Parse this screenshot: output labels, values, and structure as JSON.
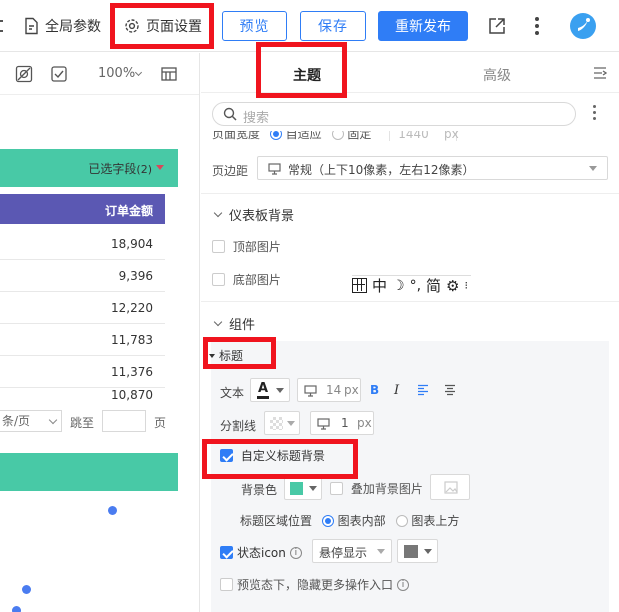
{
  "toolbar": {
    "global_params": "全局参数",
    "page_settings": "页面设置",
    "preview": "预览",
    "save": "保存",
    "republish": "重新发布"
  },
  "canvas": {
    "zoom": "100%",
    "selected_fields": "已选字段",
    "selected_count": "(2)",
    "column_header": "订单金额",
    "rows": [
      "18,904",
      "9,396",
      "12,220",
      "11,783",
      "11,376",
      "10,870"
    ],
    "page_size_suffix": "条/页",
    "jump_to": "跳至",
    "page_unit": "页"
  },
  "panel": {
    "tabs": [
      "主题",
      "高级"
    ],
    "search_placeholder": "搜索",
    "page_width": {
      "label": "页面宽度",
      "options": [
        "自适应",
        "固定"
      ],
      "fixed_value": "1440",
      "unit": "px"
    },
    "page_margin": {
      "label": "页边距",
      "value": "常规（上下10像素，左右12像素）"
    },
    "dashboard_bg": {
      "title": "仪表板背景",
      "top_image": "顶部图片",
      "bottom_image": "底部图片"
    },
    "floating_toolbar": [
      "中",
      "简"
    ],
    "components": {
      "title": "组件",
      "title_group": {
        "label": "标题",
        "text_label": "文本",
        "font_size": "14",
        "font_unit": "px",
        "bold": "B",
        "italic": "I",
        "divider_label": "分割线",
        "divider_width": "1",
        "divider_unit": "px",
        "custom_title_bg": "自定义标题背景",
        "bg_color_label": "背景色",
        "overlay_bg_image": "叠加背景图片",
        "title_area_pos_label": "标题区域位置",
        "pos_options": [
          "图表内部",
          "图表上方"
        ],
        "status_icon_label": "状态icon",
        "status_icon_mode": "悬停显示",
        "preview_hide_more": "预览态下，隐藏更多操作入口"
      }
    }
  },
  "colors": {
    "primary": "#2f7df6",
    "teal": "#48c9a6",
    "purple": "#5b58b3",
    "highlight": "#f0141e",
    "swatch_gray": "#777777"
  }
}
